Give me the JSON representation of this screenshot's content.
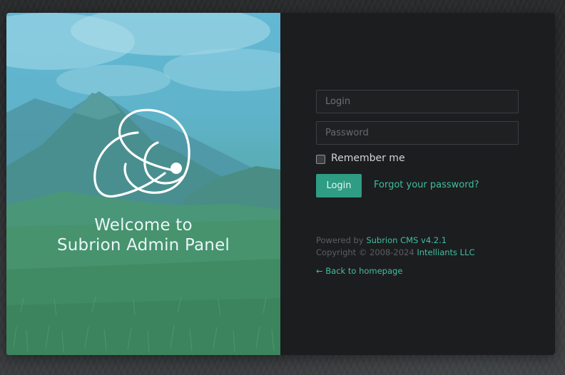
{
  "hero": {
    "welcome_line1": "Welcome to",
    "welcome_line2": "Subrion Admin Panel",
    "logo_icon": "subrion-logo-icon"
  },
  "form": {
    "login_placeholder": "Login",
    "password_placeholder": "Password",
    "remember_label": "Remember me",
    "remember_checked": false,
    "login_button": "Login",
    "forgot_link": "Forgot your password?"
  },
  "credits": {
    "powered_by_prefix": "Powered by",
    "powered_by_link": "Subrion CMS v4.2.1",
    "copyright_prefix": "Copyright © 2008-2024",
    "copyright_link": "Intelliants LLC"
  },
  "back_link": "← Back to homepage",
  "colors": {
    "accent": "#2f9c84",
    "link": "#3fbf9f",
    "panel_bg": "#1c1d1f",
    "hero_tint": "#5fb3c9"
  }
}
